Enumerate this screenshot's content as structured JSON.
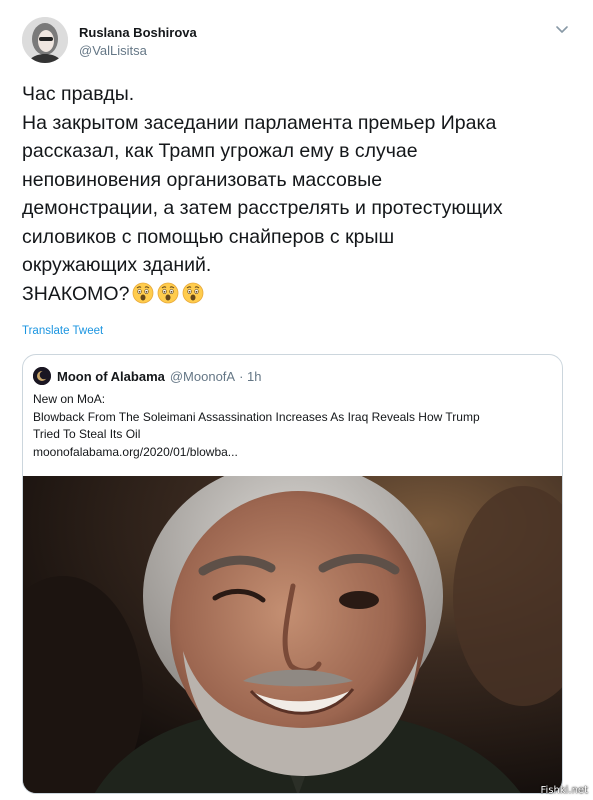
{
  "author": {
    "name": "Ruslana Boshirova",
    "handle": "@ValLisitsa"
  },
  "icons": {
    "avatar": "avatar-photo",
    "caret": "chevron-down-icon",
    "emoji": "astonished-face-emoji"
  },
  "tweet": {
    "lines": [
      "Час правды.",
      "На закрытом заседании парламента премьер Ирака",
      "рассказал, как Трамп угрожал ему в случае",
      "неповиновения организовать массовые",
      "демонстрации, а затем расстрелять и протестующих",
      "силовиков с помощью снайперов с крыш",
      "окружающих зданий.",
      "ЗНАКОМО?"
    ],
    "emoji_count": 3,
    "translate_label": "Translate Tweet"
  },
  "quoted": {
    "name": "Moon of Alabama",
    "handle": "@MoonofA",
    "time": "· 1h",
    "lines": [
      "New on MoA:",
      "Blowback From The Soleimani Assassination Increases As Iraq Reveals How Trump",
      "Tried To Steal Its Oil",
      "moonofalabama.org/2020/01/blowba..."
    ]
  },
  "watermark": "Fishki.net",
  "colors": {
    "text": "#14171a",
    "muted": "#657786",
    "link": "#1b95e0",
    "border": "#ccd6dd"
  }
}
